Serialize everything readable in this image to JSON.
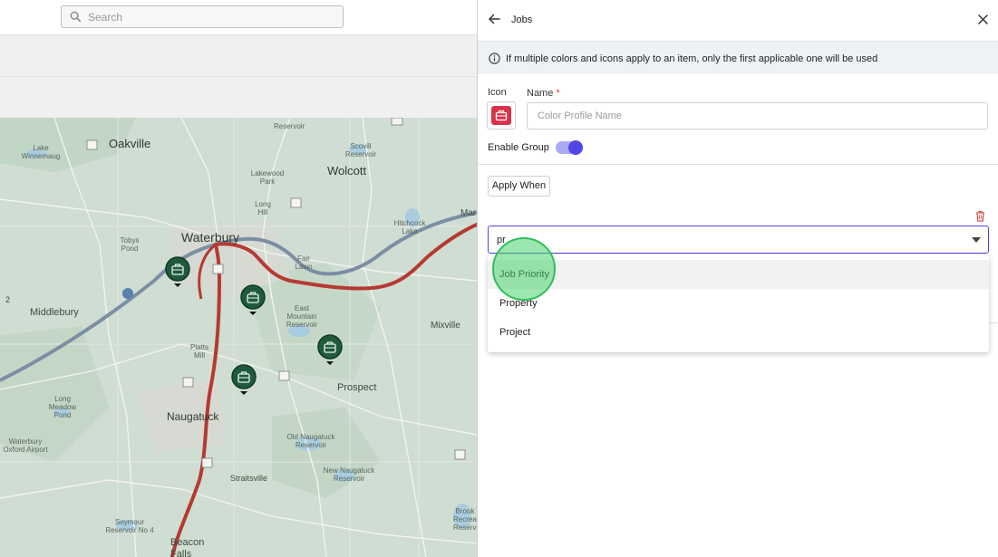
{
  "header": {
    "search_placeholder": "Search"
  },
  "map": {
    "labels": {
      "oakville": "Oakville",
      "waterbury": "Waterbury",
      "wolcott": "Wolcott",
      "middlebury": "Middlebury",
      "naugatuck": "Naugatuck",
      "prospect": "Prospect",
      "mixville": "Mixville",
      "straitsville": "Straitsville",
      "beacon_falls": "Beacon Falls",
      "fair_lawn": "Fair Lawn",
      "long_hill": "Long Hill",
      "plattsmill": "Platts Mill",
      "lakewood": "Lakewood Park",
      "lake_winnemaug": "Lake Winnemaug",
      "hitchcock": "Hitchcock Lake",
      "east_mountain": "East Mountain Reservoir",
      "old_naugatuck": "Old Naugatuck Reservoir",
      "new_naugatuck": "New Naugatuck Reservoir",
      "long_meadow": "Long Meadow Pond",
      "oxford_airport": "Waterbury Oxford Airport",
      "seymour": "Seymour Reservoir No 4",
      "tobys_pond": "Tobys Pond",
      "reservoir_top": "Reservoir",
      "scovill": "Scovill Reservoir",
      "brook": "Brook Recreation Reservoir",
      "edge_2": "2",
      "edge_mar": "Mar"
    }
  },
  "panel": {
    "title": "Jobs",
    "notice": "If multiple colors and icons apply to an item, only the first applicable one will be used",
    "icon_label": "Icon",
    "name_label": "Name",
    "name_required": "*",
    "name_placeholder": "Color Profile Name",
    "name_value": "",
    "enable_group_label": "Enable Group",
    "enable_group_on": true,
    "apply_when_label": "Apply When",
    "condition_input_value": "pr",
    "options": [
      "Job Priority",
      "Property",
      "Project"
    ],
    "highlighted_option": "Job Priority"
  },
  "colors": {
    "accent": "#4f46e5",
    "toggle_track": "#a9aaf0",
    "icon_red": "#d8334a",
    "trash_red": "#d9534f",
    "marker_green": "#1f5a3a",
    "route_red": "#b53a32"
  }
}
